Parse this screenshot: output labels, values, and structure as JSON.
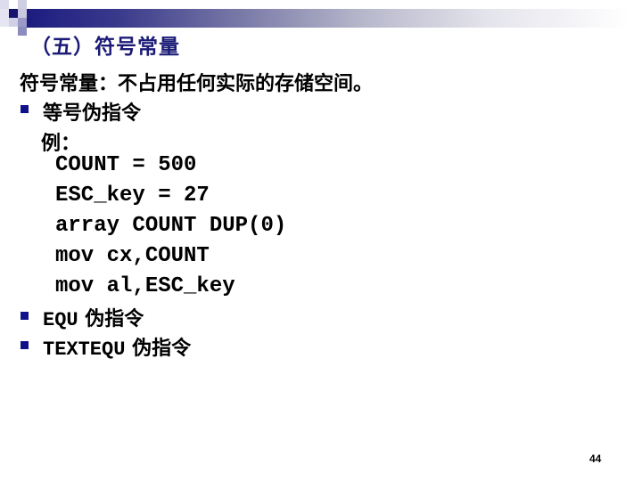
{
  "slide": {
    "title": "（五）符号常量",
    "intro": "符号常量：不占用任何实际的存储空间。",
    "bullets": [
      {
        "label": "等号伪指令",
        "icon": "square-bullet-icon"
      },
      {
        "label": "EQU伪指令",
        "icon": "square-bullet-icon"
      },
      {
        "label": "TEXTEQU伪指令",
        "icon": "square-bullet-icon"
      }
    ],
    "example_label": "例：",
    "code_lines": [
      "COUNT = 500",
      "ESC_key = 27",
      "array COUNT DUP(0)",
      "mov cx,COUNT",
      "mov al,ESC_key"
    ],
    "page_number": "44"
  },
  "colors": {
    "title": "#1b1b77",
    "bullet": "#10108a",
    "accent_dark": "#1c1c80"
  }
}
